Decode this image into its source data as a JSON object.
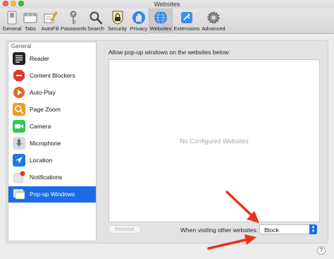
{
  "window": {
    "title": "Websites"
  },
  "toolbar": {
    "items": [
      {
        "label": "General",
        "icon": "general-switch-icon"
      },
      {
        "label": "Tabs",
        "icon": "tabs-icon"
      },
      {
        "label": "AutoFill",
        "icon": "autofill-pencil-icon"
      },
      {
        "label": "Passwords",
        "icon": "key-icon"
      },
      {
        "label": "Search",
        "icon": "magnifier-icon"
      },
      {
        "label": "Security",
        "icon": "security-lock-icon"
      },
      {
        "label": "Privacy",
        "icon": "privacy-hand-icon"
      },
      {
        "label": "Websites",
        "icon": "globe-icon",
        "active": true
      },
      {
        "label": "Extensions",
        "icon": "puzzle-icon"
      },
      {
        "label": "Advanced",
        "icon": "gear-icon"
      }
    ]
  },
  "sidebar": {
    "header": "General",
    "items": [
      {
        "label": "Reader",
        "icon": "reader-icon",
        "color": "#222222"
      },
      {
        "label": "Content Blockers",
        "icon": "stop-sign-icon",
        "color": "#e0392b"
      },
      {
        "label": "Auto-Play",
        "icon": "play-icon",
        "color": "#e8642c"
      },
      {
        "label": "Page Zoom",
        "icon": "zoom-icon",
        "color": "#f29a20"
      },
      {
        "label": "Camera",
        "icon": "camera-icon",
        "color": "#34c759"
      },
      {
        "label": "Microphone",
        "icon": "microphone-icon",
        "color": "#8e8e93"
      },
      {
        "label": "Location",
        "icon": "location-arrow-icon",
        "color": "#1f7ae0"
      },
      {
        "label": "Notifications",
        "icon": "notifications-icon",
        "color": "#d0d0d0"
      },
      {
        "label": "Pop-up Windows",
        "icon": "popup-windows-icon",
        "color": "#f0f0f0",
        "selected": true
      }
    ]
  },
  "content": {
    "prompt": "Allow pop-up windows on the websites below:",
    "empty_message": "No Configured Websites",
    "remove_label": "Remove",
    "other_websites_label": "When visiting other websites:",
    "other_websites_value": "Block"
  },
  "help": {
    "label": "?"
  },
  "colors": {
    "accent": "#1b6ce6",
    "annotation_arrow": "#e8321c"
  }
}
